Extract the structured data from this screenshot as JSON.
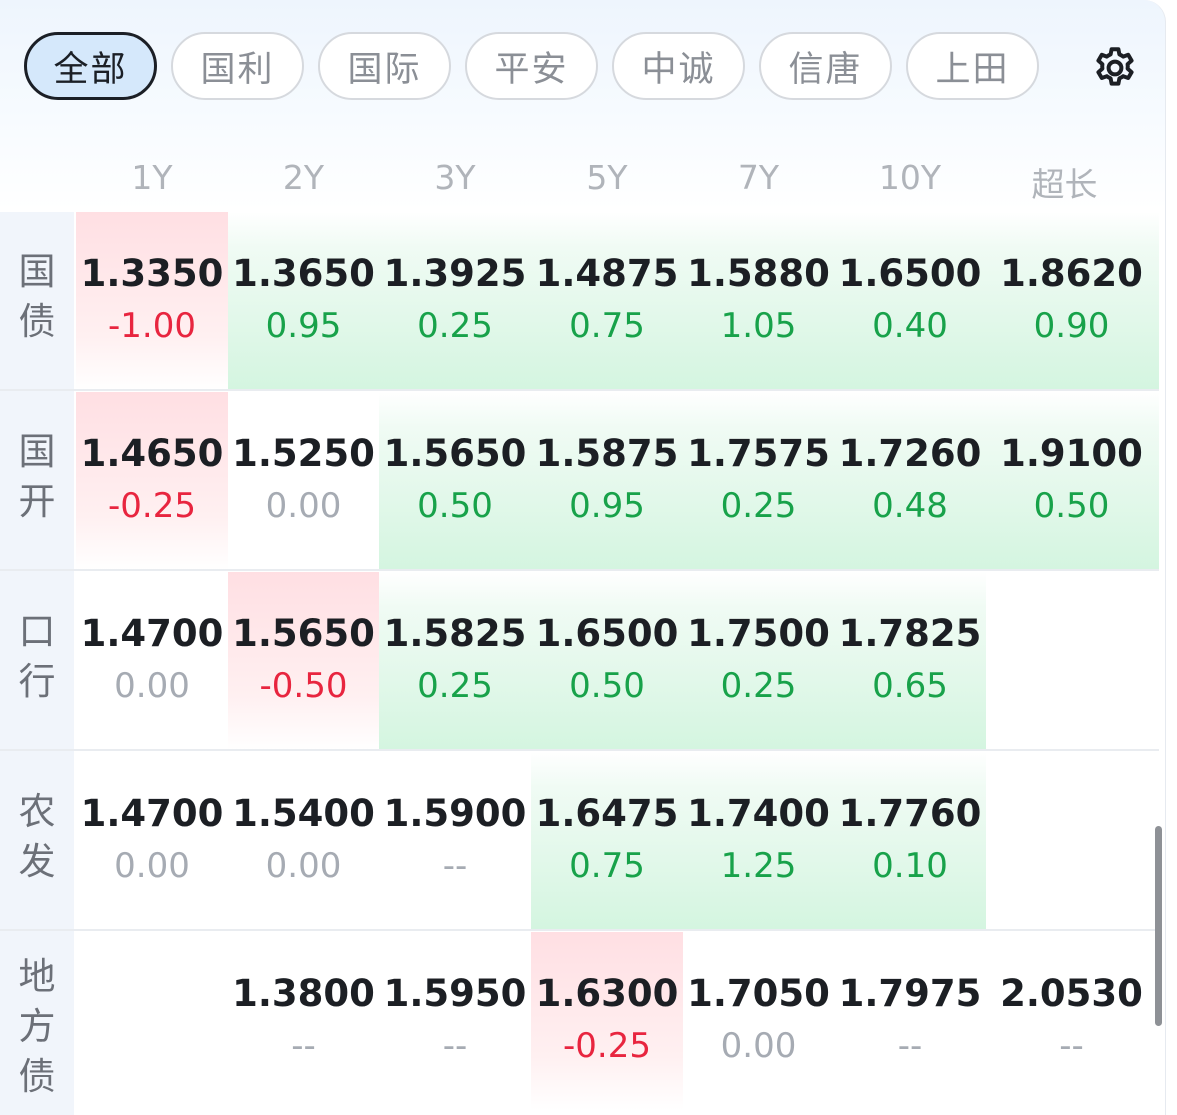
{
  "filters": [
    {
      "label": "全部",
      "active": true
    },
    {
      "label": "国利",
      "active": false
    },
    {
      "label": "国际",
      "active": false
    },
    {
      "label": "平安",
      "active": false
    },
    {
      "label": "中诚",
      "active": false
    },
    {
      "label": "信唐",
      "active": false
    },
    {
      "label": "上田",
      "active": false
    }
  ],
  "tenors": [
    "1Y",
    "2Y",
    "3Y",
    "5Y",
    "7Y",
    "10Y",
    "超长"
  ],
  "colors": {
    "up": "#e8253f",
    "down": "#18a24a",
    "flat": "#a6abb3",
    "active_pill_bg": "#d5e8fb"
  },
  "rows": [
    {
      "label_lines": [
        "国",
        "债"
      ],
      "cells": [
        {
          "rate": "1.3350",
          "chg": "-1.00",
          "tone": "up"
        },
        {
          "rate": "1.3650",
          "chg": "0.95",
          "tone": "down"
        },
        {
          "rate": "1.3925",
          "chg": "0.25",
          "tone": "down"
        },
        {
          "rate": "1.4875",
          "chg": "0.75",
          "tone": "down"
        },
        {
          "rate": "1.5880",
          "chg": "1.05",
          "tone": "down"
        },
        {
          "rate": "1.6500",
          "chg": "0.40",
          "tone": "down"
        },
        {
          "rate": "1.8620",
          "chg": "0.90",
          "tone": "down"
        }
      ]
    },
    {
      "label_lines": [
        "国",
        "开"
      ],
      "cells": [
        {
          "rate": "1.4650",
          "chg": "-0.25",
          "tone": "up"
        },
        {
          "rate": "1.5250",
          "chg": "0.00",
          "tone": "flat"
        },
        {
          "rate": "1.5650",
          "chg": "0.50",
          "tone": "down"
        },
        {
          "rate": "1.5875",
          "chg": "0.95",
          "tone": "down"
        },
        {
          "rate": "1.7575",
          "chg": "0.25",
          "tone": "down"
        },
        {
          "rate": "1.7260",
          "chg": "0.48",
          "tone": "down"
        },
        {
          "rate": "1.9100",
          "chg": "0.50",
          "tone": "down"
        }
      ]
    },
    {
      "label_lines": [
        "口",
        "行"
      ],
      "cells": [
        {
          "rate": "1.4700",
          "chg": "0.00",
          "tone": "flat"
        },
        {
          "rate": "1.5650",
          "chg": "-0.50",
          "tone": "up"
        },
        {
          "rate": "1.5825",
          "chg": "0.25",
          "tone": "down"
        },
        {
          "rate": "1.6500",
          "chg": "0.50",
          "tone": "down"
        },
        {
          "rate": "1.7500",
          "chg": "0.25",
          "tone": "down"
        },
        {
          "rate": "1.7825",
          "chg": "0.65",
          "tone": "down"
        },
        {
          "rate": "",
          "chg": "",
          "tone": "none"
        }
      ]
    },
    {
      "label_lines": [
        "农",
        "发"
      ],
      "cells": [
        {
          "rate": "1.4700",
          "chg": "0.00",
          "tone": "flat"
        },
        {
          "rate": "1.5400",
          "chg": "0.00",
          "tone": "flat"
        },
        {
          "rate": "1.5900",
          "chg": "--",
          "tone": "flat"
        },
        {
          "rate": "1.6475",
          "chg": "0.75",
          "tone": "down"
        },
        {
          "rate": "1.7400",
          "chg": "1.25",
          "tone": "down"
        },
        {
          "rate": "1.7760",
          "chg": "0.10",
          "tone": "down"
        },
        {
          "rate": "",
          "chg": "",
          "tone": "none"
        }
      ]
    },
    {
      "label_lines": [
        "地",
        "方",
        "债"
      ],
      "cells": [
        {
          "rate": "",
          "chg": "",
          "tone": "none"
        },
        {
          "rate": "1.3800",
          "chg": "--",
          "tone": "flat"
        },
        {
          "rate": "1.5950",
          "chg": "--",
          "tone": "flat"
        },
        {
          "rate": "1.6300",
          "chg": "-0.25",
          "tone": "up"
        },
        {
          "rate": "1.7050",
          "chg": "0.00",
          "tone": "flat"
        },
        {
          "rate": "1.7975",
          "chg": "--",
          "tone": "flat"
        },
        {
          "rate": "2.0530",
          "chg": "--",
          "tone": "flat"
        }
      ]
    }
  ]
}
